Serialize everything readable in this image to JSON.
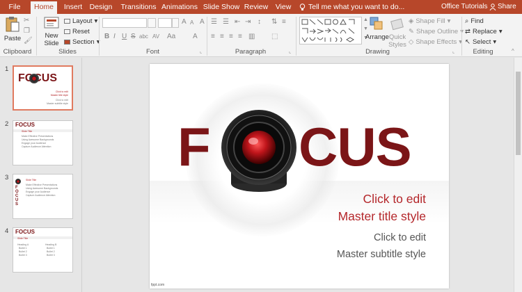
{
  "tabs": [
    {
      "label": "File",
      "active": false
    },
    {
      "label": "Home",
      "active": true
    },
    {
      "label": "Insert",
      "active": false
    },
    {
      "label": "Design",
      "active": false
    },
    {
      "label": "Transitions",
      "active": false
    },
    {
      "label": "Animations",
      "active": false
    },
    {
      "label": "Slide Show",
      "active": false
    },
    {
      "label": "Review",
      "active": false
    },
    {
      "label": "View",
      "active": false
    }
  ],
  "tell_me": "Tell me what you want to do...",
  "account": "Office Tutorials",
  "share": "Share",
  "ribbon": {
    "clipboard": {
      "paste": "Paste",
      "label": "Clipboard"
    },
    "slides": {
      "new_slide_line1": "New",
      "new_slide_line2": "Slide",
      "layout": "Layout",
      "reset": "Reset",
      "section": "Section",
      "label": "Slides"
    },
    "font": {
      "label": "Font",
      "bold": "B",
      "italic": "I",
      "underline": "U",
      "strike": "S",
      "shadow": "abc",
      "spacing": "AV",
      "case": "Aa",
      "grow": "A",
      "shrink": "A",
      "clear": "A"
    },
    "paragraph": {
      "label": "Paragraph"
    },
    "drawing": {
      "arrange": "Arrange",
      "quick_styles_line1": "Quick",
      "quick_styles_line2": "Styles",
      "shape_fill": "Shape Fill",
      "shape_outline": "Shape Outline",
      "shape_effects": "Shape Effects",
      "label": "Drawing"
    },
    "editing": {
      "find": "Find",
      "replace": "Replace",
      "select": "Select",
      "label": "Editing"
    }
  },
  "thumbnails": [
    {
      "number": "1",
      "title": "FOCUS",
      "lines": [
        "Click to edit",
        "Master title style",
        "Click to edit",
        "Master subtitle style"
      ]
    },
    {
      "number": "2",
      "title": "FOCUS",
      "heading": "Slide Title",
      "bullets": [
        "Make Effective Presentations",
        "Using Awesome Backgrounds",
        "Engage your Audience",
        "Capture Audience Attention"
      ]
    },
    {
      "number": "3",
      "title": "FOCUS",
      "heading": "Slide Title",
      "bullets": [
        "Make Effective Presentations",
        "Using Awesome Backgrounds",
        "Engage your Audience",
        "Capture Audience Attention"
      ]
    },
    {
      "number": "4",
      "title": "FOCUS",
      "heading": "Slide Title",
      "col1_head": "Heading A",
      "col2_head": "Heading B",
      "col_items": [
        "Bullet 1",
        "Bullet 2",
        "Bullet 3"
      ]
    }
  ],
  "slide": {
    "focus_f": "F",
    "focus_cus": "CUS",
    "title_line1": "Click to edit",
    "title_line2": "Master title style",
    "subtitle_line1": "Click to edit",
    "subtitle_line2": "Master subtitle style",
    "footer": "fppt.com",
    "colors": {
      "focus": "#7b1517",
      "title": "#b4262a",
      "accent": "#b7472a"
    }
  }
}
